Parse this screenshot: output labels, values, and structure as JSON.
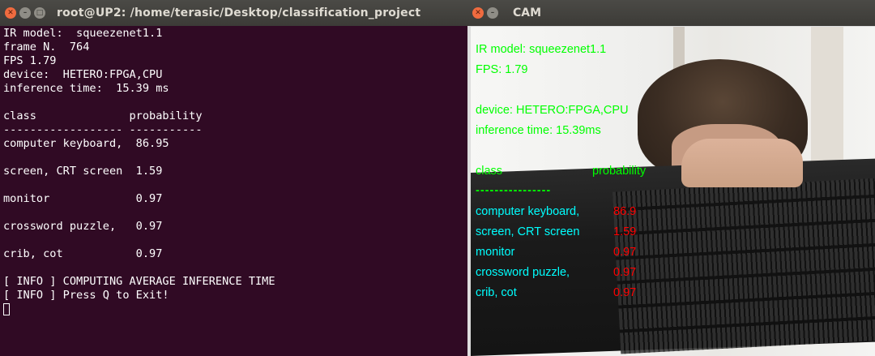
{
  "terminal": {
    "title": "root@UP2: /home/terasic/Desktop/classification_project",
    "lines": [
      "IR model:  squeezenet1.1",
      "frame N.  764",
      "FPS 1.79",
      "device:  HETERO:FPGA,CPU",
      "inference time:  15.39 ms",
      "",
      "class              probability",
      "------------------ -----------",
      "computer keyboard,  86.95",
      "",
      "screen, CRT screen  1.59",
      "",
      "monitor             0.97",
      "",
      "crossword puzzle,   0.97",
      "",
      "crib, cot           0.97",
      "",
      "[ INFO ] COMPUTING AVERAGE INFERENCE TIME",
      "[ INFO ] Press Q to Exit!"
    ]
  },
  "cam": {
    "title": "CAM",
    "overlay": {
      "model": "IR model: squeezenet1.1",
      "fps": "FPS: 1.79",
      "device": "device: HETERO:FPGA,CPU",
      "inference": "inference time: 15.39ms",
      "header_class": "class",
      "header_prob": "probability",
      "divider": "----------------",
      "results": [
        {
          "label": "computer keyboard,",
          "prob": "86.9"
        },
        {
          "label": "screen, CRT screen",
          "prob": "1.59"
        },
        {
          "label": "monitor",
          "prob": "0.97"
        },
        {
          "label": "crossword puzzle,",
          "prob": "0.97"
        },
        {
          "label": "crib, cot",
          "prob": "0.97"
        }
      ]
    }
  },
  "icons": {
    "close": "close-icon",
    "minimize": "minimize-icon",
    "maximize": "maximize-icon"
  },
  "colors": {
    "terminal_bg": "#300a24",
    "overlay_green": "#00ff00",
    "overlay_cyan": "#00ffff",
    "overlay_red": "#ff0000"
  }
}
